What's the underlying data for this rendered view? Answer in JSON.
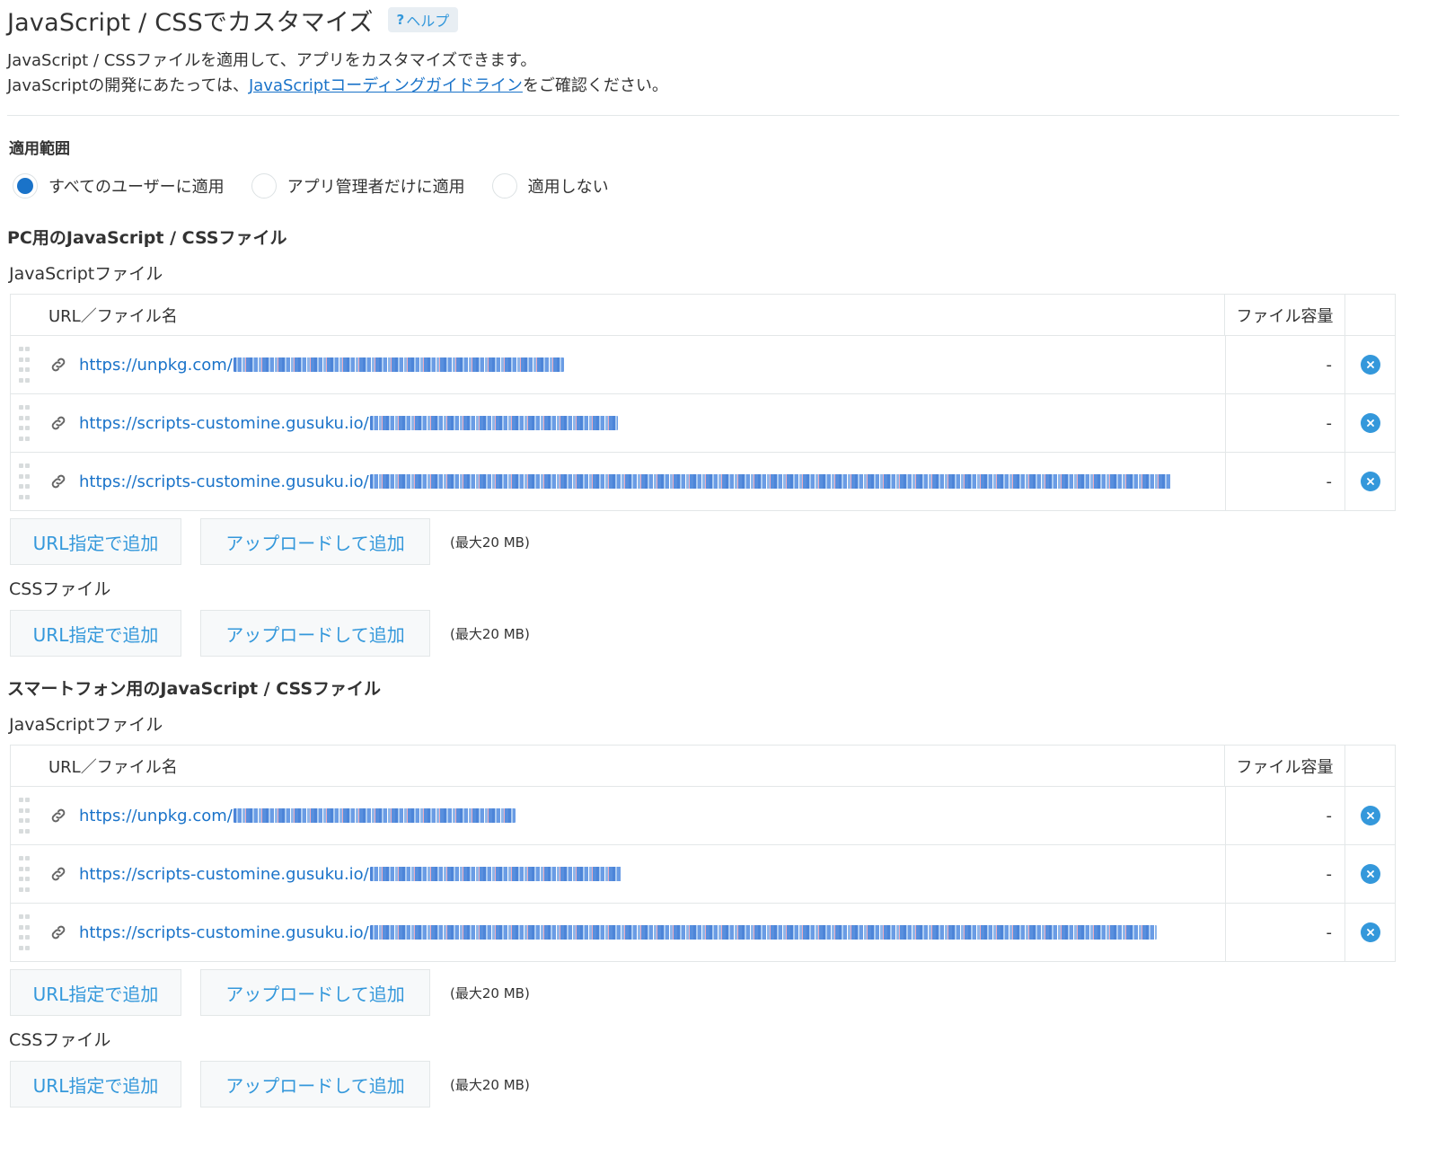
{
  "header": {
    "title": "JavaScript / CSSでカスタマイズ",
    "help_label": "ヘルプ",
    "help_icon": "question-icon"
  },
  "description": {
    "line1": "JavaScript / CSSファイルを適用して、アプリをカスタマイズできます。",
    "line2_before": "JavaScriptの開発にあたっては、",
    "line2_link": "JavaScriptコーディングガイドライン",
    "line2_after": "をご確認ください。"
  },
  "scope": {
    "heading": "適用範囲",
    "options": [
      {
        "label": "すべてのユーザーに適用",
        "selected": true
      },
      {
        "label": "アプリ管理者だけに適用",
        "selected": false
      },
      {
        "label": "適用しない",
        "selected": false
      }
    ]
  },
  "table_headers": {
    "name": "URL／ファイル名",
    "size": "ファイル容量"
  },
  "buttons": {
    "add_url": "URL指定で追加",
    "upload": "アップロードして追加",
    "max_note": "(最大20 MB)"
  },
  "pc": {
    "heading": "PC用のJavaScript / CSSファイル",
    "js_label": "JavaScriptファイル",
    "css_label": "CSSファイル",
    "js_files": [
      {
        "url": "https://unpkg.com/",
        "size": "-"
      },
      {
        "url": "https://scripts-customine.gusuku.io/",
        "size": "-"
      },
      {
        "url": "https://scripts-customine.gusuku.io/",
        "size": "-"
      }
    ]
  },
  "mobile": {
    "heading": "スマートフォン用のJavaScript / CSSファイル",
    "js_label": "JavaScriptファイル",
    "css_label": "CSSファイル",
    "js_files": [
      {
        "url": "https://unpkg.com/",
        "size": "-"
      },
      {
        "url": "https://scripts-customine.gusuku.io/",
        "size": "-"
      },
      {
        "url": "https://scripts-customine.gusuku.io/",
        "size": "-"
      }
    ]
  },
  "colors": {
    "link": "#1a73c9",
    "accent": "#3498db",
    "border": "#e3e7e8",
    "button_bg": "#f7f9fa"
  }
}
